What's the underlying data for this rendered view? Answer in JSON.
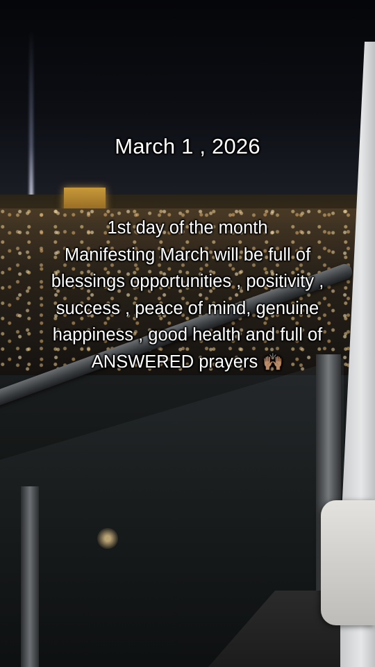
{
  "overlay": {
    "date": "March 1 , 2026",
    "message_lines": [
      "1st day of the month",
      "Manifesting March will be full of",
      "blessings opportunities , positivity ,",
      "success , peace of mind, genuine",
      "happiness , good health and full of",
      "ANSWERED prayers"
    ],
    "emoji": "🙌🏽"
  }
}
